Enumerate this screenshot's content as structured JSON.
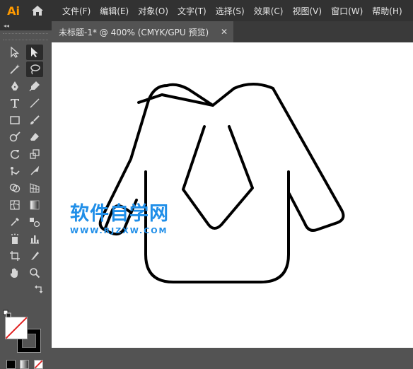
{
  "app": {
    "logo": "Ai"
  },
  "menu": [
    "文件(F)",
    "编辑(E)",
    "对象(O)",
    "文字(T)",
    "选择(S)",
    "效果(C)",
    "视图(V)",
    "窗口(W)",
    "帮助(H)"
  ],
  "panel": {
    "collapse_glyph": "◂◂"
  },
  "document_tab": {
    "title": "未标题-1* @ 400% (CMYK/GPU 预览)",
    "close_glyph": "✕"
  },
  "tools": [
    "selection-tool",
    "direct-selection-tool",
    "magic-wand-tool",
    "lasso-tool",
    "pen-tool",
    "curvature-tool",
    "type-tool",
    "line-segment-tool",
    "rectangle-tool",
    "paintbrush-tool",
    "shaper-tool",
    "eraser-tool",
    "rotate-tool",
    "scale-tool",
    "puppet-warp-tool",
    "free-transform-tool",
    "shape-builder-tool",
    "perspective-grid-tool",
    "mesh-tool",
    "gradient-tool",
    "eyedropper-tool",
    "blend-tool",
    "symbol-sprayer-tool",
    "column-graph-tool",
    "artboard-tool",
    "slice-tool",
    "hand-tool",
    "zoom-tool"
  ],
  "colors": {
    "fill": "#ffffff",
    "stroke": "#000000",
    "accent_logo": "#ff9a00",
    "watermark": "#1f8ee8"
  },
  "watermark": {
    "main": "软件自学网",
    "sub": "WWW.RJZXW.COM"
  }
}
